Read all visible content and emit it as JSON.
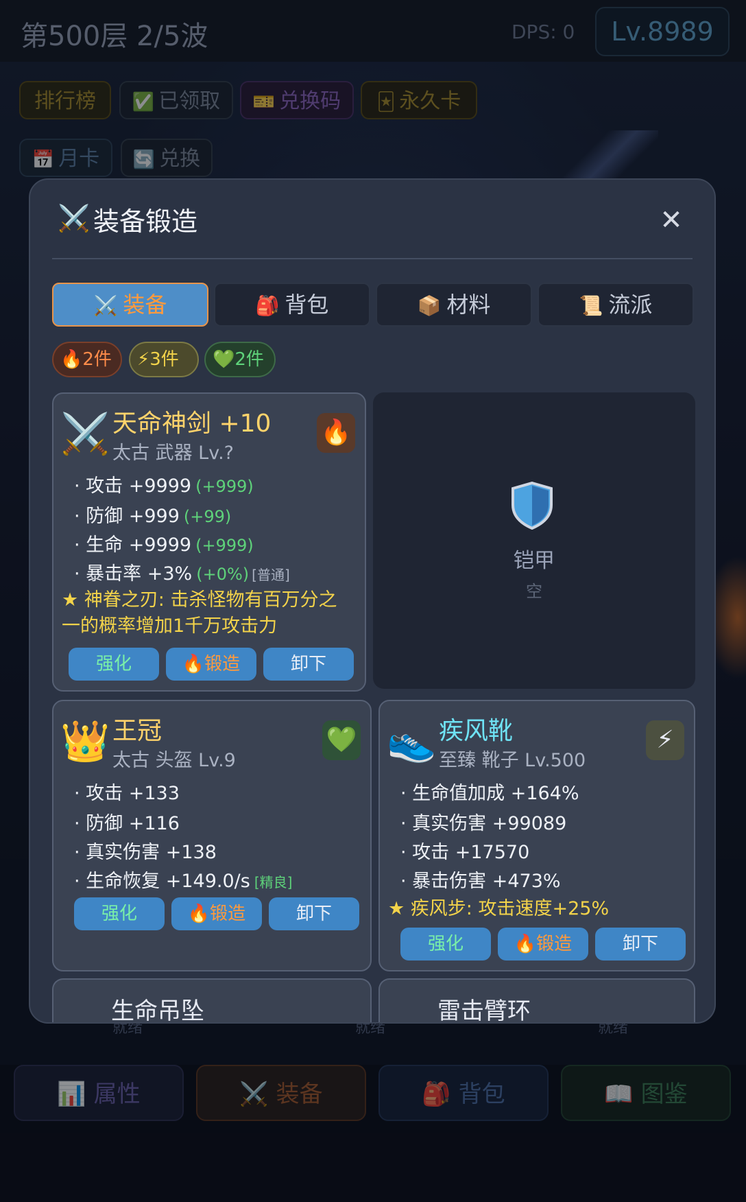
{
  "header": {
    "floor_title": "第500层 2/5波",
    "dps": "DPS: 0",
    "level": "Lv.8989"
  },
  "wave_progress_fraction": 0.68,
  "top_buttons": {
    "rank": "排行榜",
    "claimed": "已领取",
    "redeem_code": "兑换码",
    "permanent_card": "永久卡",
    "monthly_card": "月卡",
    "exchange": "兑换"
  },
  "bottom_status": [
    "就绪",
    "就绪",
    "就绪"
  ],
  "bottom_nav": {
    "attributes": "属性",
    "equipment": "装备",
    "bag": "背包",
    "codex": "图鉴"
  },
  "modal": {
    "title": "装备锻造",
    "tabs": [
      {
        "icon": "crossed-swords-icon",
        "label": "装备",
        "active": true
      },
      {
        "icon": "backpack-icon",
        "label": "背包",
        "active": false
      },
      {
        "icon": "box-icon",
        "label": "材料",
        "active": false
      },
      {
        "icon": "scroll-icon",
        "label": "流派",
        "active": false
      }
    ],
    "set_badges": [
      {
        "icon": "fire-icon",
        "label": "2件"
      },
      {
        "icon": "lightning-icon",
        "label": "3件"
      },
      {
        "icon": "heart-icon",
        "label": "2件"
      }
    ],
    "cards": [
      {
        "name": "天命神剑 +10",
        "name_color": "#ffd36b",
        "subtitle": "太古 武器  Lv.?",
        "icon": "crossed-swords-icon",
        "set_icon": "fire-icon",
        "stats": [
          {
            "label": "· 攻击 +9999",
            "bonus": "(+999)"
          },
          {
            "label": "· 防御 +999",
            "bonus": "(+99)"
          },
          {
            "label": "· 生命 +9999",
            "bonus": "(+999)"
          },
          {
            "label": "· 暴击率 +3%",
            "bonus": "(+0%)",
            "tag": "[普通]"
          }
        ],
        "special": "★ 神眷之刃: 击杀怪物有百万分之一的概率增加1千万攻击力",
        "actions": {
          "enhance": "强化",
          "forge": "锻造",
          "unequip": "卸下"
        }
      },
      {
        "name": "王冠",
        "name_color": "#ffd36b",
        "subtitle": "太古 头盔  Lv.9",
        "icon": "crown-icon",
        "set_icon": "heart-icon",
        "stats": [
          {
            "label": "· 攻击 +133"
          },
          {
            "label": "· 防御 +116"
          },
          {
            "label": "· 真实伤害 +138"
          },
          {
            "label": "· 生命恢复 +149.0/s",
            "tag": "[精良]"
          }
        ],
        "actions": {
          "enhance": "强化",
          "forge": "锻造",
          "unequip": "卸下"
        }
      },
      {
        "name": "疾风靴",
        "name_color": "#6fe3f5",
        "subtitle": "至臻 靴子  Lv.500",
        "icon": "sneaker-icon",
        "set_icon": "lightning-icon",
        "stats": [
          {
            "label": "· 生命值加成 +164%"
          },
          {
            "label": "· 真实伤害 +99089"
          },
          {
            "label": "· 攻击 +17570"
          },
          {
            "label": "· 暴击伤害 +473%"
          }
        ],
        "special": "★ 疾风步: 攻击速度+25%",
        "actions": {
          "enhance": "强化",
          "forge": "锻造",
          "unequip": "卸下"
        }
      }
    ],
    "empty_slot": {
      "label": "铠甲",
      "state": "空",
      "icon": "shield-icon"
    },
    "peek_cards": [
      {
        "name": "生命吊坠"
      },
      {
        "name": "雷击臂环"
      }
    ]
  }
}
